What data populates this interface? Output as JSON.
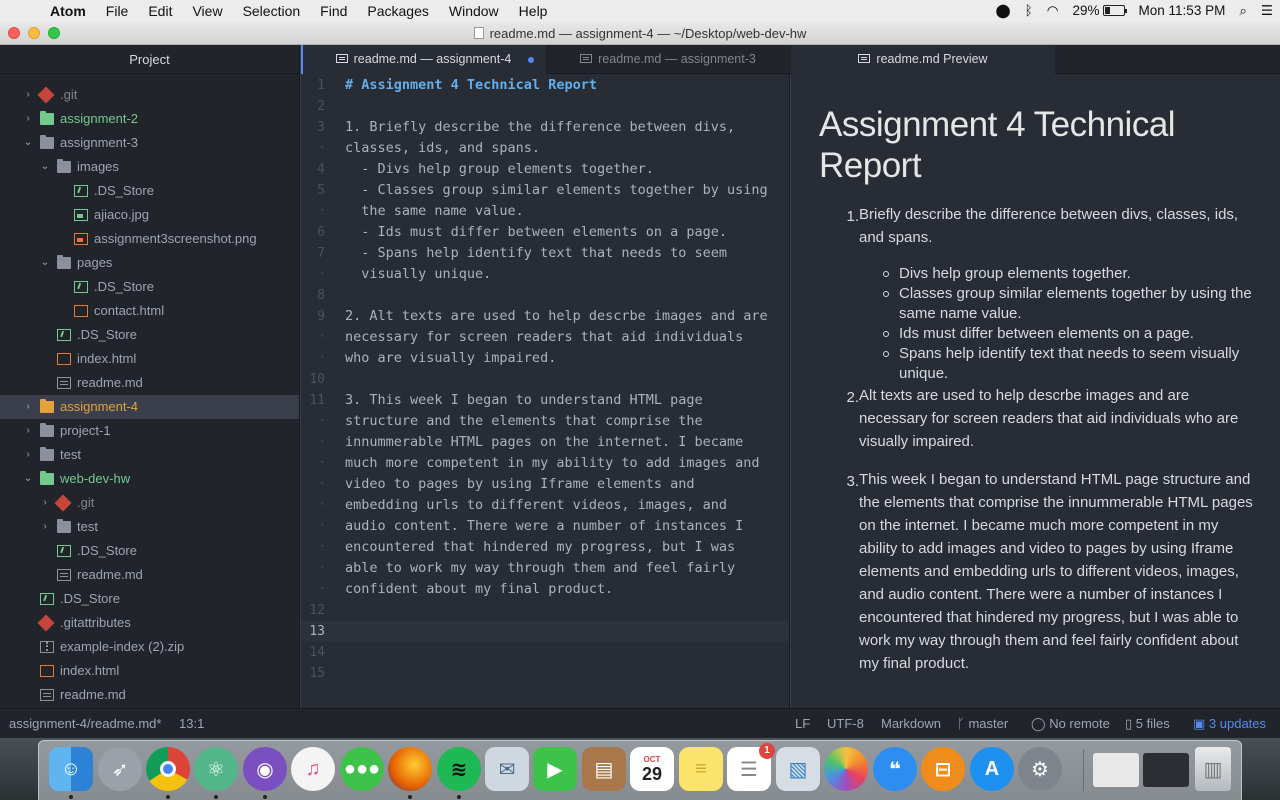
{
  "menubar": {
    "app_name": "Atom",
    "items": [
      "File",
      "Edit",
      "View",
      "Selection",
      "Find",
      "Packages",
      "Window",
      "Help"
    ],
    "battery": "29%",
    "clock": "Mon 11:53 PM"
  },
  "window": {
    "title": "readme.md — assignment-4 — ~/Desktop/web-dev-hw"
  },
  "sidebar": {
    "header": "Project",
    "rows": [
      {
        "label": ".git",
        "type": "git",
        "depth": 1,
        "arrow": "›",
        "color": "dim"
      },
      {
        "label": "assignment-2",
        "type": "folder-green",
        "depth": 1,
        "arrow": "›",
        "color": "green"
      },
      {
        "label": "assignment-3",
        "type": "folder",
        "depth": 1,
        "arrow": "⌄",
        "color": ""
      },
      {
        "label": "images",
        "type": "folder",
        "depth": 2,
        "arrow": "⌄",
        "color": ""
      },
      {
        "label": ".DS_Store",
        "type": "ds",
        "depth": 3,
        "arrow": "",
        "color": ""
      },
      {
        "label": "ajiaco.jpg",
        "type": "img-green",
        "depth": 3,
        "arrow": "",
        "color": ""
      },
      {
        "label": "assignment3screenshot.png",
        "type": "img",
        "depth": 3,
        "arrow": "",
        "color": ""
      },
      {
        "label": "pages",
        "type": "folder",
        "depth": 2,
        "arrow": "⌄",
        "color": ""
      },
      {
        "label": ".DS_Store",
        "type": "ds",
        "depth": 3,
        "arrow": "",
        "color": ""
      },
      {
        "label": "contact.html",
        "type": "html",
        "depth": 3,
        "arrow": "",
        "color": ""
      },
      {
        "label": ".DS_Store",
        "type": "ds",
        "depth": 2,
        "arrow": "",
        "color": ""
      },
      {
        "label": "index.html",
        "type": "html",
        "depth": 2,
        "arrow": "",
        "color": ""
      },
      {
        "label": "readme.md",
        "type": "md",
        "depth": 2,
        "arrow": "",
        "color": ""
      },
      {
        "label": "assignment-4",
        "type": "folder-orange",
        "depth": 1,
        "arrow": "›",
        "color": "orange",
        "selected": true
      },
      {
        "label": "project-1",
        "type": "folder",
        "depth": 1,
        "arrow": "›",
        "color": ""
      },
      {
        "label": "test",
        "type": "folder",
        "depth": 1,
        "arrow": "›",
        "color": ""
      },
      {
        "label": "web-dev-hw",
        "type": "folder-green",
        "depth": 1,
        "arrow": "⌄",
        "color": "green"
      },
      {
        "label": ".git",
        "type": "git",
        "depth": 2,
        "arrow": "›",
        "color": "dim"
      },
      {
        "label": "test",
        "type": "folder",
        "depth": 2,
        "arrow": "›",
        "color": ""
      },
      {
        "label": ".DS_Store",
        "type": "ds",
        "depth": 2,
        "arrow": "",
        "color": ""
      },
      {
        "label": "readme.md",
        "type": "md",
        "depth": 2,
        "arrow": "",
        "color": ""
      },
      {
        "label": ".DS_Store",
        "type": "ds",
        "depth": 1,
        "arrow": "",
        "color": ""
      },
      {
        "label": ".gitattributes",
        "type": "git",
        "depth": 1,
        "arrow": "",
        "color": ""
      },
      {
        "label": "example-index (2).zip",
        "type": "zip",
        "depth": 1,
        "arrow": "",
        "color": ""
      },
      {
        "label": "index.html",
        "type": "html",
        "depth": 1,
        "arrow": "",
        "color": ""
      },
      {
        "label": "readme.md",
        "type": "md",
        "depth": 1,
        "arrow": "",
        "color": ""
      }
    ]
  },
  "tabs": {
    "editor_active": "readme.md — assignment-4",
    "editor_inactive": "readme.md — assignment-3",
    "preview": "readme.md Preview"
  },
  "editor": {
    "lines": [
      {
        "n": "1",
        "text": "# Assignment 4 Technical Report",
        "heading": true
      },
      {
        "n": "2",
        "text": ""
      },
      {
        "n": "3",
        "text": "1. Briefly describe the difference between divs,"
      },
      {
        "n": "•",
        "text": "classes, ids, and spans."
      },
      {
        "n": "4",
        "text": "  - Divs help group elements together."
      },
      {
        "n": "5",
        "text": "  - Classes group similar elements together by using"
      },
      {
        "n": "•",
        "text": "  the same name value."
      },
      {
        "n": "6",
        "text": "  - Ids must differ between elements on a page."
      },
      {
        "n": "7",
        "text": "  - Spans help identify text that needs to seem"
      },
      {
        "n": "•",
        "text": "  visually unique."
      },
      {
        "n": "8",
        "text": ""
      },
      {
        "n": "9",
        "text": "2. Alt texts are used to help descrbe images and are"
      },
      {
        "n": "•",
        "text": "necessary for screen readers that aid individuals"
      },
      {
        "n": "•",
        "text": "who are visually impaired."
      },
      {
        "n": "10",
        "text": ""
      },
      {
        "n": "11",
        "text": "3. This week I began to understand HTML page"
      },
      {
        "n": "•",
        "text": "structure and the elements that comprise the"
      },
      {
        "n": "•",
        "text": "innummerable HTML pages on the internet. I became"
      },
      {
        "n": "•",
        "text": "much more competent in my ability to add images and"
      },
      {
        "n": "•",
        "text": "video to pages by using Iframe elements and"
      },
      {
        "n": "•",
        "text": "embedding urls to different videos, images, and"
      },
      {
        "n": "•",
        "text": "audio content. There were a number of instances I"
      },
      {
        "n": "•",
        "text": "encountered that hindered my progress, but I was"
      },
      {
        "n": "•",
        "text": "able to work my way through them and feel fairly"
      },
      {
        "n": "•",
        "text": "confident about my final product."
      },
      {
        "n": "12",
        "text": ""
      },
      {
        "n": "13",
        "text": "",
        "cursor": true
      },
      {
        "n": "14",
        "text": ""
      },
      {
        "n": "15",
        "text": ""
      }
    ]
  },
  "preview": {
    "title": "Assignment 4 Technical Report",
    "item1": {
      "num": "1.",
      "text": "Briefly describe the difference between divs, classes, ids, and spans."
    },
    "bullets": [
      "Divs help group elements together.",
      "Classes group similar elements together by using the same name value.",
      "Ids must differ between elements on a page.",
      "Spans help identify text that needs to seem visually unique."
    ],
    "item2": {
      "num": "2.",
      "text": "Alt texts are used to help descrbe images and are necessary for screen readers that aid individuals who are visually impaired."
    },
    "item3": {
      "num": "3.",
      "text": "This week I began to understand HTML page structure and the elements that comprise the innummerable HTML pages on the internet. I became much more competent in my ability to add images and video to pages by using Iframe elements and embedding urls to different videos, images, and audio content. There were a number of instances I encountered that hindered my progress, but I was able to work my way through them and feel fairly confident about my final product."
    }
  },
  "statusbar": {
    "file": "assignment-4/readme.md*",
    "cursor": "13:1",
    "line_ending": "LF",
    "encoding": "UTF-8",
    "grammar": "Markdown",
    "branch": "master",
    "remote": "No remote",
    "files": "5 files",
    "updates": "3 updates"
  },
  "dock": {
    "calendar_month": "OCT",
    "calendar_day": "29",
    "reminders_badge": "1",
    "apps": [
      "finder",
      "launchpad",
      "chrome",
      "atom",
      "github-desktop",
      "itunes",
      "messages",
      "firefox",
      "spotify",
      "mail",
      "facetime",
      "contacts",
      "calendar",
      "notes",
      "reminders",
      "preview",
      "photos",
      "messages-bubble",
      "ibooks",
      "app-store",
      "system-preferences"
    ]
  }
}
